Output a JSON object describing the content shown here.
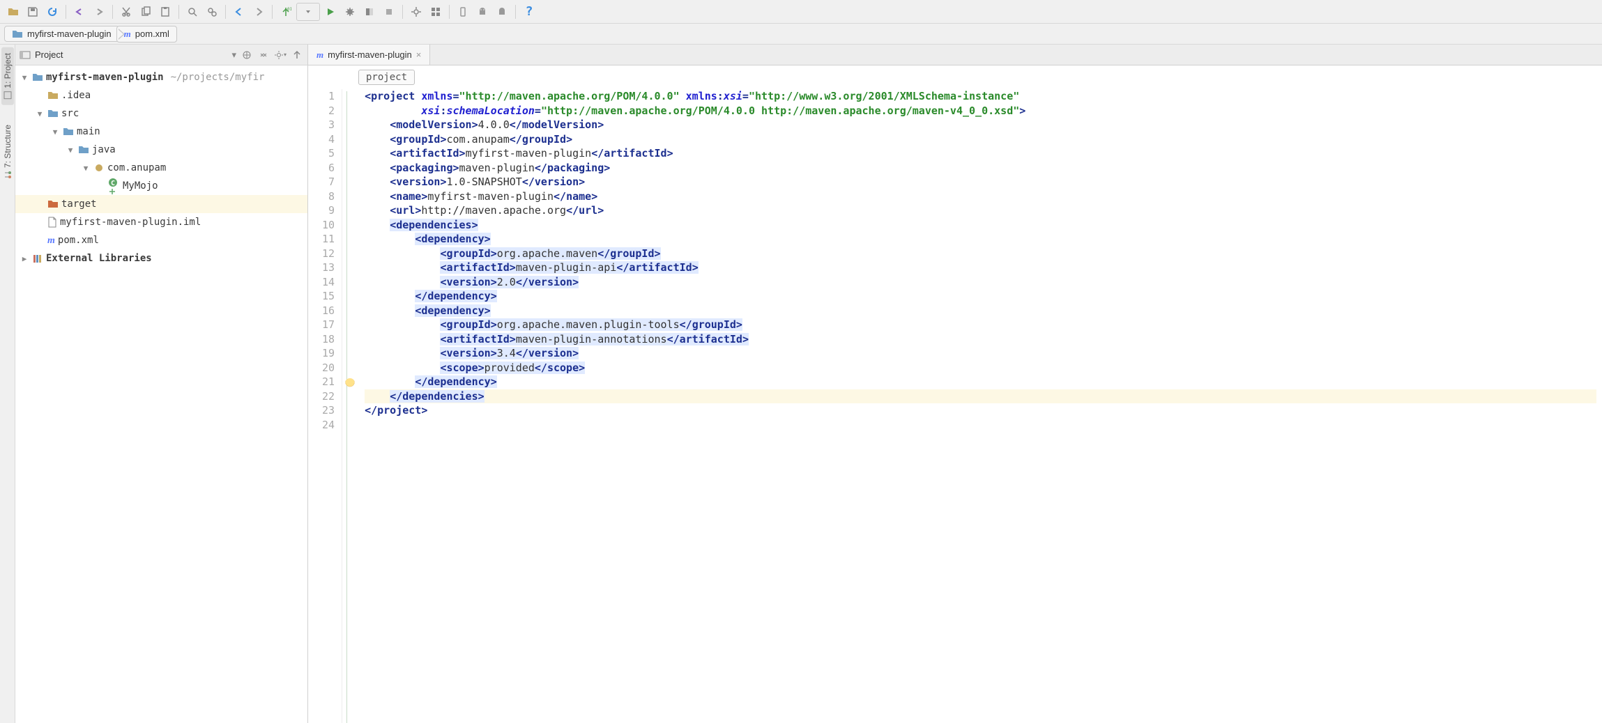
{
  "toolbar": {
    "buttons": [
      "open",
      "save",
      "refresh",
      "undo",
      "redo",
      "cut",
      "copy",
      "paste",
      "zoom-in",
      "zoom-out",
      "back",
      "forward",
      "sort",
      "dropdown",
      "run",
      "debug",
      "debug2",
      "stop",
      "settings",
      "profile",
      "device",
      "android",
      "android2",
      "help"
    ]
  },
  "breadcrumb": {
    "items": [
      {
        "icon": "folder-blue",
        "label": "myfirst-maven-plugin"
      },
      {
        "icon": "m",
        "label": "pom.xml"
      }
    ]
  },
  "sidebar_tabs": {
    "project": "1: Project",
    "structure": "7: Structure"
  },
  "project_panel": {
    "title": "Project"
  },
  "tree": {
    "root": {
      "label": "myfirst-maven-plugin",
      "path": "~/projects/myfir",
      "children": [
        {
          "label": ".idea",
          "icon": "folder",
          "indent": 1,
          "exp": false
        },
        {
          "label": "src",
          "icon": "folder-blue",
          "indent": 1,
          "exp": true,
          "children": [
            {
              "label": "main",
              "icon": "folder-blue",
              "indent": 2,
              "exp": true,
              "children": [
                {
                  "label": "java",
                  "icon": "folder-blue",
                  "indent": 3,
                  "exp": true,
                  "children": [
                    {
                      "label": "com.anupam",
                      "icon": "package",
                      "indent": 4,
                      "exp": true,
                      "children": [
                        {
                          "label": "MyMojo",
                          "icon": "class",
                          "indent": 5
                        }
                      ]
                    }
                  ]
                }
              ]
            }
          ]
        },
        {
          "label": "target",
          "icon": "folder-red",
          "indent": 1,
          "exp": false,
          "hl": true
        },
        {
          "label": "myfirst-maven-plugin.iml",
          "icon": "file",
          "indent": 1
        },
        {
          "label": "pom.xml",
          "icon": "m",
          "indent": 1
        }
      ]
    },
    "ext_lib": "External Libraries"
  },
  "editor": {
    "tab_label": "myfirst-maven-plugin",
    "crumb": "project",
    "line_count": 24,
    "lines": [
      {
        "n": 1,
        "tokens": [
          [
            "br",
            "<"
          ],
          [
            "tag",
            "project"
          ],
          [
            "text",
            " "
          ],
          [
            "attr",
            "xmlns"
          ],
          [
            "br",
            "="
          ],
          [
            "str",
            "\"http://maven.apache.org/POM/4.0.0\""
          ],
          [
            "text",
            " "
          ],
          [
            "attr",
            "xmlns"
          ],
          [
            "br",
            ":"
          ],
          [
            "attr2",
            "xsi"
          ],
          [
            "br",
            "="
          ],
          [
            "str",
            "\"http://www.w3.org/2001/XMLSchema-instance\""
          ]
        ]
      },
      {
        "n": 2,
        "indent": 9,
        "tokens": [
          [
            "attr2",
            "xsi"
          ],
          [
            "br",
            ":"
          ],
          [
            "attr2",
            "schemaLocation"
          ],
          [
            "br",
            "="
          ],
          [
            "str",
            "\"http://maven.apache.org/POM/4.0.0 http://maven.apache.org/maven-v4_0_0.xsd\""
          ],
          [
            "br",
            ">"
          ]
        ]
      },
      {
        "n": 3,
        "indent": 4,
        "tokens": [
          [
            "br",
            "<"
          ],
          [
            "tag",
            "modelVersion"
          ],
          [
            "br",
            ">"
          ],
          [
            "text",
            "4.0.0"
          ],
          [
            "br",
            "</"
          ],
          [
            "tag",
            "modelVersion"
          ],
          [
            "br",
            ">"
          ]
        ]
      },
      {
        "n": 4,
        "indent": 4,
        "tokens": [
          [
            "br",
            "<"
          ],
          [
            "tag",
            "groupId"
          ],
          [
            "br",
            ">"
          ],
          [
            "text",
            "com.anupam"
          ],
          [
            "br",
            "</"
          ],
          [
            "tag",
            "groupId"
          ],
          [
            "br",
            ">"
          ]
        ]
      },
      {
        "n": 5,
        "indent": 4,
        "tokens": [
          [
            "br",
            "<"
          ],
          [
            "tag",
            "artifactId"
          ],
          [
            "br",
            ">"
          ],
          [
            "text",
            "myfirst-maven-plugin"
          ],
          [
            "br",
            "</"
          ],
          [
            "tag",
            "artifactId"
          ],
          [
            "br",
            ">"
          ]
        ]
      },
      {
        "n": 6,
        "indent": 4,
        "tokens": [
          [
            "br",
            "<"
          ],
          [
            "tag",
            "packaging"
          ],
          [
            "br",
            ">"
          ],
          [
            "text",
            "maven-plugin"
          ],
          [
            "br",
            "</"
          ],
          [
            "tag",
            "packaging"
          ],
          [
            "br",
            ">"
          ]
        ]
      },
      {
        "n": 7,
        "indent": 4,
        "tokens": [
          [
            "br",
            "<"
          ],
          [
            "tag",
            "version"
          ],
          [
            "br",
            ">"
          ],
          [
            "text",
            "1.0-SNAPSHOT"
          ],
          [
            "br",
            "</"
          ],
          [
            "tag",
            "version"
          ],
          [
            "br",
            ">"
          ]
        ]
      },
      {
        "n": 8,
        "indent": 4,
        "tokens": [
          [
            "br",
            "<"
          ],
          [
            "tag",
            "name"
          ],
          [
            "br",
            ">"
          ],
          [
            "text",
            "myfirst-maven-plugin"
          ],
          [
            "br",
            "</"
          ],
          [
            "tag",
            "name"
          ],
          [
            "br",
            ">"
          ]
        ]
      },
      {
        "n": 9,
        "indent": 4,
        "tokens": [
          [
            "br",
            "<"
          ],
          [
            "tag",
            "url"
          ],
          [
            "br",
            ">"
          ],
          [
            "text",
            "http://maven.apache.org"
          ],
          [
            "br",
            "</"
          ],
          [
            "tag",
            "url"
          ],
          [
            "br",
            ">"
          ]
        ]
      },
      {
        "n": 10,
        "indent": 4,
        "sel": true,
        "tokens": [
          [
            "br",
            "<"
          ],
          [
            "tag",
            "dependencies"
          ],
          [
            "br",
            ">"
          ]
        ]
      },
      {
        "n": 11,
        "indent": 8,
        "sel": true,
        "tokens": [
          [
            "br",
            "<"
          ],
          [
            "tag",
            "dependency"
          ],
          [
            "br",
            ">"
          ]
        ]
      },
      {
        "n": 12,
        "indent": 12,
        "sel": true,
        "tokens": [
          [
            "br",
            "<"
          ],
          [
            "tag",
            "groupId"
          ],
          [
            "br",
            ">"
          ],
          [
            "text",
            "org.apache.maven"
          ],
          [
            "br",
            "</"
          ],
          [
            "tag",
            "groupId"
          ],
          [
            "br",
            ">"
          ]
        ]
      },
      {
        "n": 13,
        "indent": 12,
        "sel": true,
        "tokens": [
          [
            "br",
            "<"
          ],
          [
            "tag",
            "artifactId"
          ],
          [
            "br",
            ">"
          ],
          [
            "text",
            "maven-plugin-api"
          ],
          [
            "br",
            "</"
          ],
          [
            "tag",
            "artifactId"
          ],
          [
            "br",
            ">"
          ]
        ]
      },
      {
        "n": 14,
        "indent": 12,
        "sel": true,
        "tokens": [
          [
            "br",
            "<"
          ],
          [
            "tag",
            "version"
          ],
          [
            "br",
            ">"
          ],
          [
            "text",
            "2.0"
          ],
          [
            "br",
            "</"
          ],
          [
            "tag",
            "version"
          ],
          [
            "br",
            ">"
          ]
        ]
      },
      {
        "n": 15,
        "indent": 8,
        "sel": true,
        "tokens": [
          [
            "br",
            "</"
          ],
          [
            "tag",
            "dependency"
          ],
          [
            "br",
            ">"
          ]
        ]
      },
      {
        "n": 16,
        "indent": 8,
        "sel": true,
        "tokens": [
          [
            "br",
            "<"
          ],
          [
            "tag",
            "dependency"
          ],
          [
            "br",
            ">"
          ]
        ]
      },
      {
        "n": 17,
        "indent": 12,
        "sel": true,
        "tokens": [
          [
            "br",
            "<"
          ],
          [
            "tag",
            "groupId"
          ],
          [
            "br",
            ">"
          ],
          [
            "text",
            "org.apache.maven.plugin-tools"
          ],
          [
            "br",
            "</"
          ],
          [
            "tag",
            "groupId"
          ],
          [
            "br",
            ">"
          ]
        ]
      },
      {
        "n": 18,
        "indent": 12,
        "sel": true,
        "tokens": [
          [
            "br",
            "<"
          ],
          [
            "tag",
            "artifactId"
          ],
          [
            "br",
            ">"
          ],
          [
            "text",
            "maven-plugin-annotations"
          ],
          [
            "br",
            "</"
          ],
          [
            "tag",
            "artifactId"
          ],
          [
            "br",
            ">"
          ]
        ]
      },
      {
        "n": 19,
        "indent": 12,
        "sel": true,
        "tokens": [
          [
            "br",
            "<"
          ],
          [
            "tag",
            "version"
          ],
          [
            "br",
            ">"
          ],
          [
            "text",
            "3.4"
          ],
          [
            "br",
            "</"
          ],
          [
            "tag",
            "version"
          ],
          [
            "br",
            ">"
          ]
        ]
      },
      {
        "n": 20,
        "indent": 12,
        "sel": true,
        "tokens": [
          [
            "br",
            "<"
          ],
          [
            "tag",
            "scope"
          ],
          [
            "br",
            ">"
          ],
          [
            "text",
            "provided"
          ],
          [
            "br",
            "</"
          ],
          [
            "tag",
            "scope"
          ],
          [
            "br",
            ">"
          ]
        ]
      },
      {
        "n": 21,
        "indent": 8,
        "sel": true,
        "tokens": [
          [
            "br",
            "</"
          ],
          [
            "tag",
            "dependency"
          ],
          [
            "br",
            ">"
          ]
        ]
      },
      {
        "n": 22,
        "indent": 4,
        "sel": true,
        "hl": true,
        "tokens": [
          [
            "br",
            "</"
          ],
          [
            "tag",
            "dependencies"
          ],
          [
            "br",
            ">"
          ]
        ]
      },
      {
        "n": 23,
        "tokens": [
          [
            "br",
            "</"
          ],
          [
            "tag",
            "project"
          ],
          [
            "br",
            ">"
          ]
        ]
      },
      {
        "n": 24,
        "tokens": []
      }
    ]
  }
}
